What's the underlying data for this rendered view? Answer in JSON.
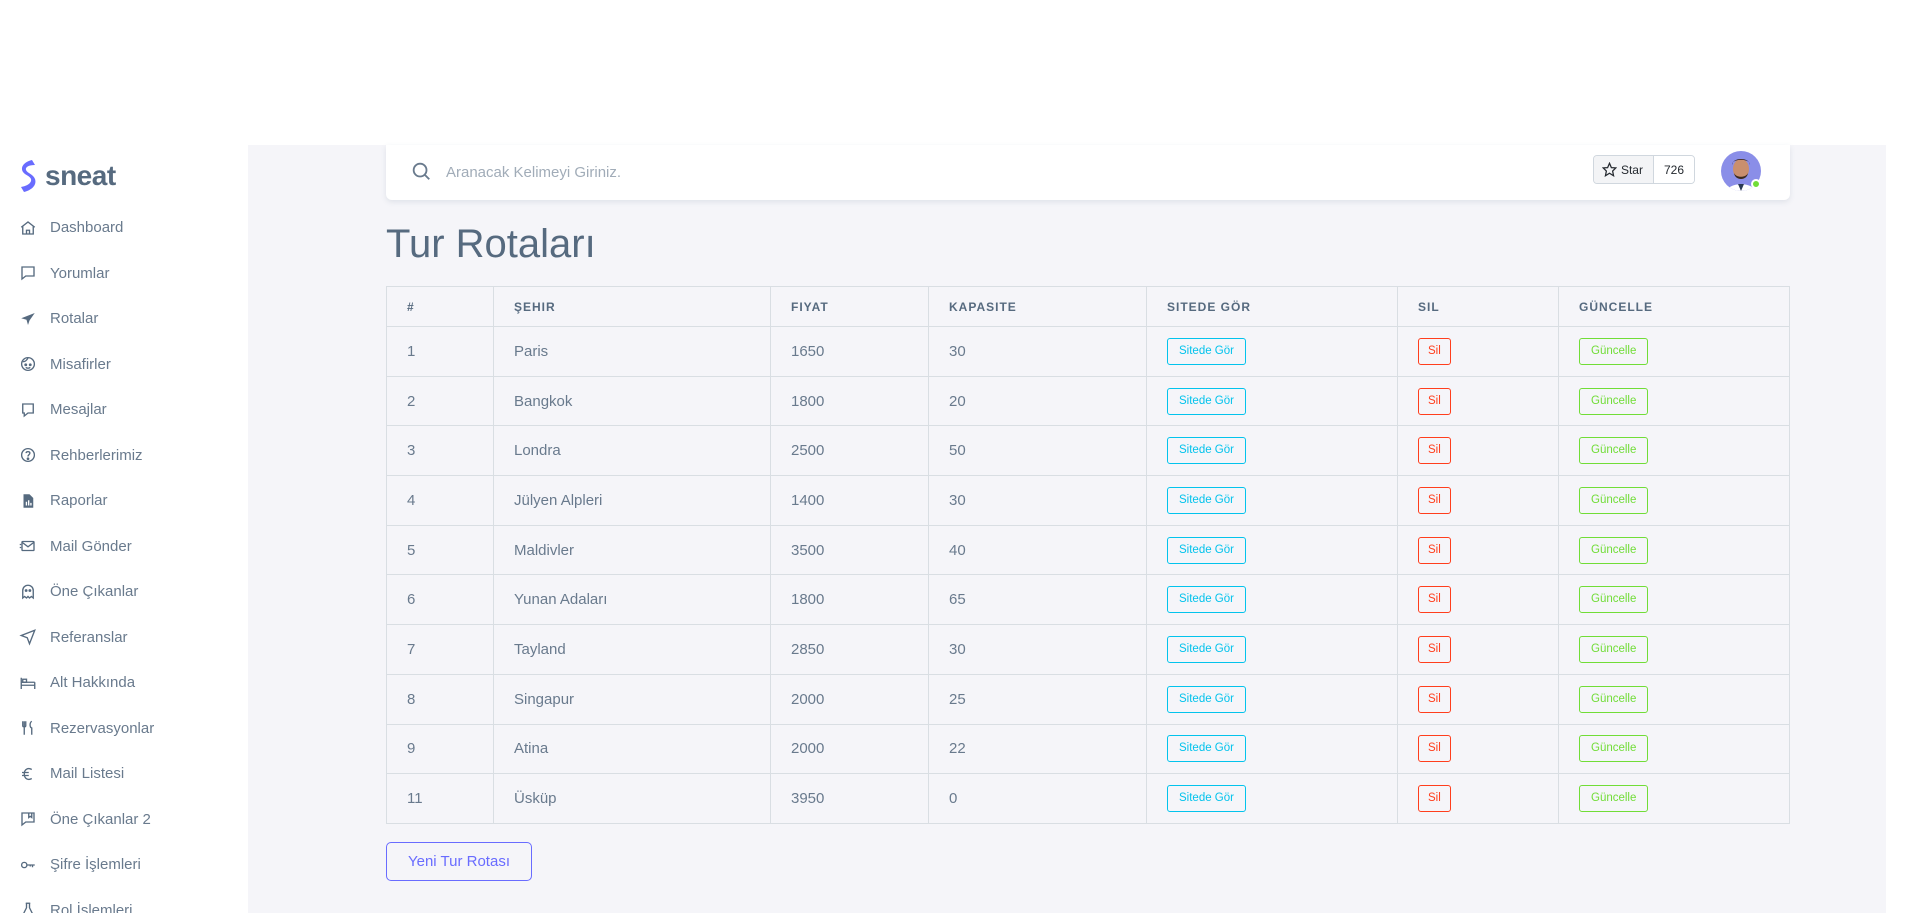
{
  "brand": {
    "name": "sneat",
    "color": "#696cff"
  },
  "sidebar": {
    "items": [
      {
        "label": "Dashboard",
        "icon": "home-icon"
      },
      {
        "label": "Yorumlar",
        "icon": "message-square-icon"
      },
      {
        "label": "Rotalar",
        "icon": "plane-icon"
      },
      {
        "label": "Misafirler",
        "icon": "face-icon"
      },
      {
        "label": "Mesajlar",
        "icon": "chat-icon"
      },
      {
        "label": "Rehberlerimiz",
        "icon": "help-circle-icon"
      },
      {
        "label": "Raporlar",
        "icon": "report-icon"
      },
      {
        "label": "Mail Gönder",
        "icon": "mail-send-icon"
      },
      {
        "label": "Öne Çıkanlar",
        "icon": "ghost-icon"
      },
      {
        "label": "Referanslar",
        "icon": "navigation-icon"
      },
      {
        "label": "Alt Hakkında",
        "icon": "bed-icon"
      },
      {
        "label": "Rezervasyonlar",
        "icon": "restaurant-icon"
      },
      {
        "label": "Mail Listesi",
        "icon": "euro-icon"
      },
      {
        "label": "Öne Çıkanlar 2",
        "icon": "comment-bookmark-icon"
      },
      {
        "label": "Şifre İşlemleri",
        "icon": "key-icon"
      },
      {
        "label": "Rol İşlemleri",
        "icon": "flask-icon"
      }
    ]
  },
  "navbar": {
    "search_placeholder": "Aranacak Kelimeyi Giriniz.",
    "star_label": "Star",
    "star_count": "726"
  },
  "page": {
    "title": "Tur Rotaları",
    "new_button": "Yeni Tur Rotası"
  },
  "table": {
    "headers": [
      "#",
      "ŞEHIR",
      "FIYAT",
      "KAPASITE",
      "SITEDE GÖR",
      "SIL",
      "GÜNCELLE"
    ],
    "view_label": "Sitede Gör",
    "delete_label": "Sil",
    "update_label": "Güncelle",
    "rows": [
      {
        "id": "1",
        "city": "Paris",
        "price": "1650",
        "capacity": "30"
      },
      {
        "id": "2",
        "city": "Bangkok",
        "price": "1800",
        "capacity": "20"
      },
      {
        "id": "3",
        "city": "Londra",
        "price": "2500",
        "capacity": "50"
      },
      {
        "id": "4",
        "city": "Jülyen Alpleri",
        "price": "1400",
        "capacity": "30"
      },
      {
        "id": "5",
        "city": "Maldivler",
        "price": "3500",
        "capacity": "40"
      },
      {
        "id": "6",
        "city": "Yunan Adaları",
        "price": "1800",
        "capacity": "65"
      },
      {
        "id": "7",
        "city": "Tayland",
        "price": "2850",
        "capacity": "30"
      },
      {
        "id": "8",
        "city": "Singapur",
        "price": "2000",
        "capacity": "25"
      },
      {
        "id": "9",
        "city": "Atina",
        "price": "2000",
        "capacity": "22"
      },
      {
        "id": "11",
        "city": "Üsküp",
        "price": "3950",
        "capacity": "0"
      }
    ]
  },
  "colors": {
    "info": "#03c3ec",
    "danger": "#ff3e1d",
    "success": "#71dd37",
    "primary": "#696cff",
    "online": "#71dd37"
  }
}
